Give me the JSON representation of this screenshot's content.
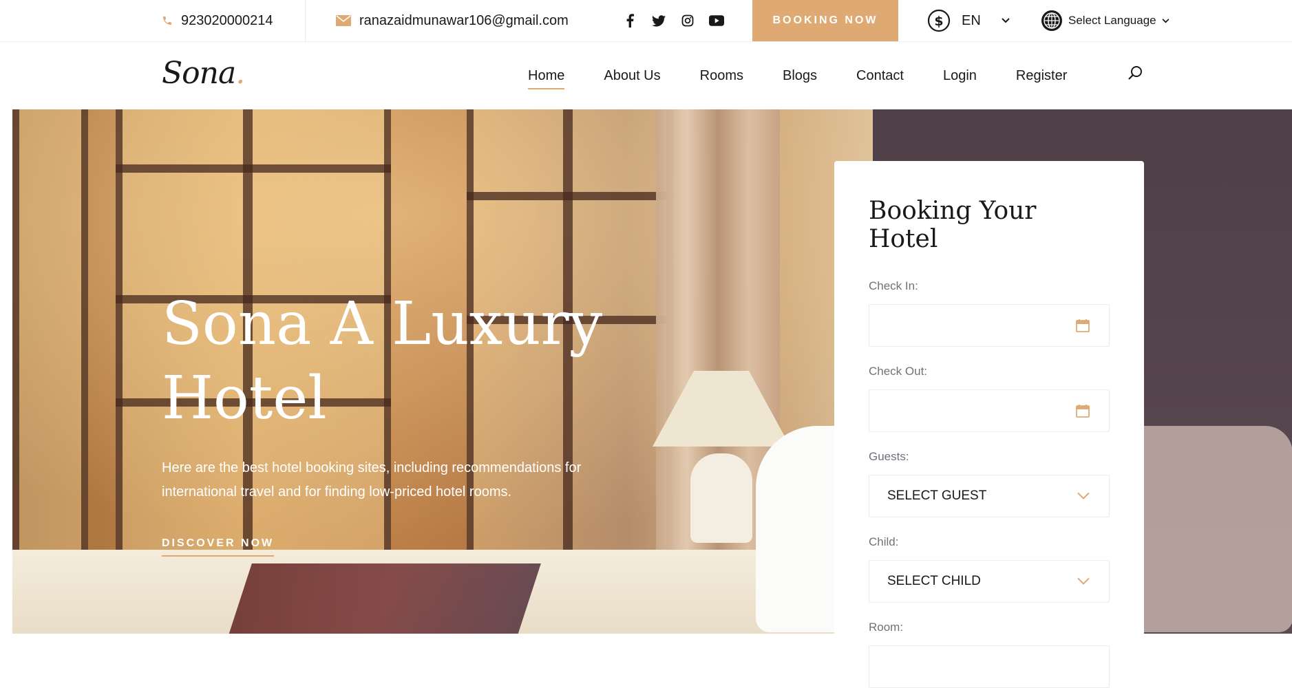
{
  "topbar": {
    "phone": "923020000214",
    "email": "ranazaidmunawar106@gmail.com",
    "social_icons": [
      "facebook-icon",
      "twitter-icon",
      "instagram-icon",
      "youtube-icon"
    ],
    "booking_label": "BOOKING NOW",
    "currency_label": "EN",
    "language_label": "Select Language"
  },
  "nav": {
    "logo_text": "Sona",
    "logo_dot": ".",
    "items": [
      {
        "label": "Home",
        "active": true
      },
      {
        "label": "About Us"
      },
      {
        "label": "Rooms"
      },
      {
        "label": "Blogs"
      },
      {
        "label": "Contact"
      },
      {
        "label": "Login"
      },
      {
        "label": "Register"
      }
    ]
  },
  "hero": {
    "title_line1": "Sona A Luxury",
    "title_line2": "Hotel",
    "subtitle": "Here are the best hotel booking sites, including recommendations for international travel and for finding low-priced hotel rooms.",
    "cta": "DISCOVER NOW"
  },
  "booking": {
    "title": "Booking Your Hotel",
    "check_in_label": "Check In:",
    "check_out_label": "Check Out:",
    "guests_label": "Guests:",
    "guests_value": "SELECT GUEST",
    "child_label": "Child:",
    "child_value": "SELECT CHILD",
    "room_label": "Room:"
  },
  "colors": {
    "accent": "#dfa974",
    "text": "#19191a",
    "muted": "#707079",
    "border": "#ebebeb"
  }
}
